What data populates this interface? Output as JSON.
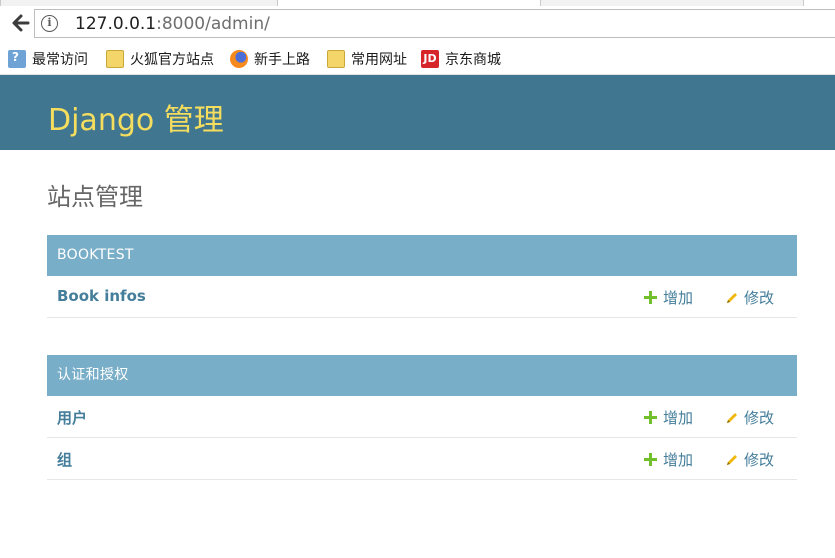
{
  "browser": {
    "url_host": "127.0.0.1",
    "url_rest": ":8000/admin/",
    "bookmarks": [
      {
        "label": "最常访问",
        "icon": "most-visited-icon"
      },
      {
        "label": "火狐官方站点",
        "icon": "folder-icon"
      },
      {
        "label": "新手上路",
        "icon": "firefox-icon"
      },
      {
        "label": "常用网址",
        "icon": "folder-icon"
      },
      {
        "label": "京东商城",
        "icon": "jd-icon",
        "icon_text": "JD"
      }
    ]
  },
  "header": {
    "brand": "Django 管理"
  },
  "main": {
    "title": "站点管理",
    "modules": [
      {
        "caption": "BOOKTEST",
        "rows": [
          {
            "name": "Book infos",
            "add": "增加",
            "change": "修改"
          }
        ]
      },
      {
        "caption": "认证和授权",
        "rows": [
          {
            "name": "用户",
            "add": "增加",
            "change": "修改"
          },
          {
            "name": "组",
            "add": "增加",
            "change": "修改"
          }
        ]
      }
    ]
  },
  "colors": {
    "header_bg": "#417690",
    "brand": "#f5dd5d",
    "caption_bg": "#79aec8",
    "link": "#447e9b",
    "add_icon": "#70bf2b",
    "change_icon": "#efb80b"
  }
}
